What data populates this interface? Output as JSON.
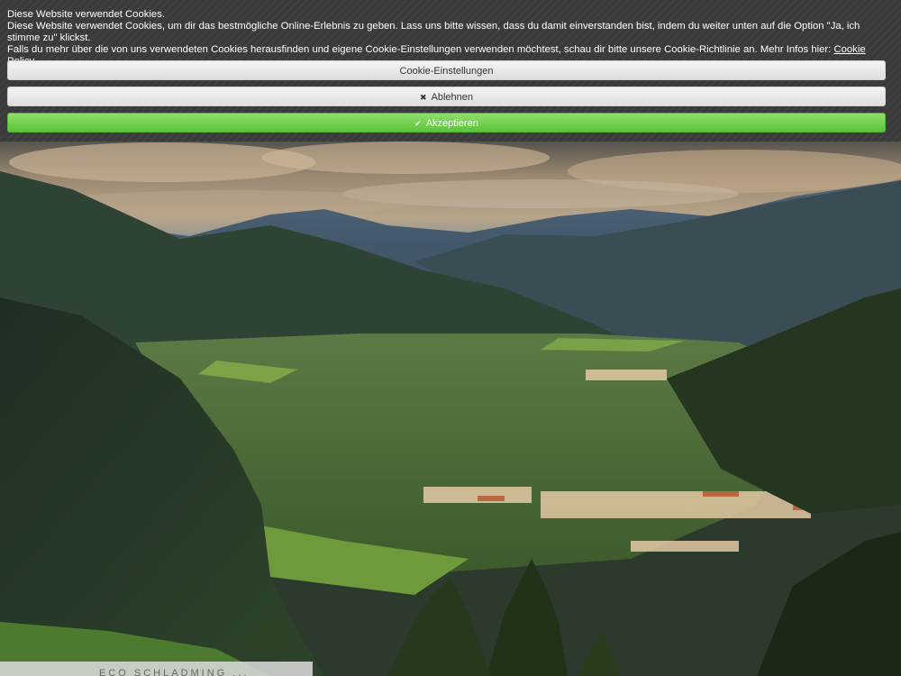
{
  "cookie": {
    "title": "Diese Website verwendet Cookies.",
    "line1": "Diese Website verwendet Cookies, um dir das bestmögliche Online-Erlebnis zu geben. Lass uns bitte wissen, dass du damit einverstanden bist, indem du weiter unten auf die Option \"Ja, ich stimme zu\" klickst.",
    "line2": "Falls du mehr über die von uns verwendeten Cookies herausfinden und eigene Cookie-Einstellungen verwenden möchtest, schau dir bitte unsere Cookie-Richtlinie an. Mehr Infos hier:",
    "policy_link": "Cookie Policy",
    "settings_label": "Cookie-Einstellungen",
    "decline_label": "Ablehnen",
    "accept_label": "Akzeptieren",
    "decline_icon": "close-icon",
    "accept_icon": "check-icon",
    "accept_color": "#6fd24b"
  },
  "footer": {
    "text": "ECO SCHLADMING ..."
  }
}
